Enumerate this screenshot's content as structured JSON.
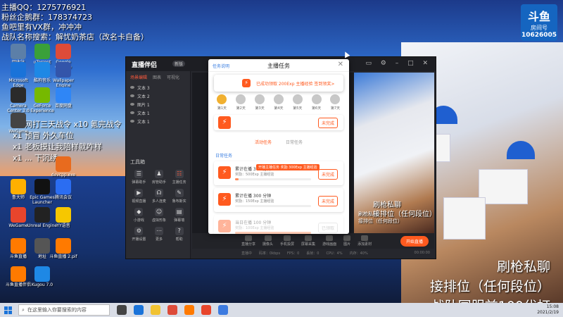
{
  "overlay_lines": [
    "主播QQ：1275776921",
    "粉丝企鹅群：178374723",
    "鱼吧里有VX群，冲冲冲",
    "战队名称搜索：解忧奶茶店（改名卡自备）"
  ],
  "gift_lines": [
    "x1 网打三天战令 x10 氪完战令",
    "x1 预冒 外久车位",
    "x1 老板摸让我陪样就咋样",
    "x1 ... 下沉绣"
  ],
  "promo_lines": [
    "刷枪私聊",
    "接排位（任何段位）",
    "战队国服前100代打"
  ],
  "preview_lines": [
    "刷枪私聊",
    "接排位（任何段位）"
  ],
  "douyu": {
    "mark": "斗鱼",
    "sub": "房间号",
    "room": "10626005"
  },
  "desktop_icons": [
    {
      "label": "回收站",
      "color": "#5c7fa8"
    },
    {
      "label": "uTorrent",
      "color": "#3aa03a"
    },
    {
      "label": "Google Chrome",
      "color": "#dd4b39"
    },
    {
      "label": "Microsoft Edge",
      "color": "#1a73d9"
    },
    {
      "label": "酷狗音乐",
      "color": "#1e88e5"
    },
    {
      "label": "Wallpaper Engine",
      "color": "#3355aa"
    },
    {
      "label": "Camera Center 3.0",
      "color": "#2b2b2b"
    },
    {
      "label": "GeForce Experience",
      "color": "#76b900"
    },
    {
      "label": "百度网盘",
      "color": "#2f86f6"
    },
    {
      "label": "WeGame",
      "color": "#444"
    },
    {
      "label": "devcpp.exe",
      "color": "#e86b1e"
    },
    {
      "label": "鲁大师",
      "color": "#ffb000"
    },
    {
      "label": "Epic Games Launcher",
      "color": "#111"
    },
    {
      "label": "腾讯会议",
      "color": "#2b6df2"
    },
    {
      "label": "WeGame",
      "color": "#e8452c"
    },
    {
      "label": "Unreal Engine",
      "color": "#222"
    },
    {
      "label": "YY语音",
      "color": "#f6c700"
    },
    {
      "label": "斗鱼直播",
      "color": "#ff7a00"
    },
    {
      "label": "地址",
      "color": "#555"
    },
    {
      "label": "斗鱼直播 2.pif",
      "color": "#ff7a00"
    },
    {
      "label": "斗鱼直播伴侣",
      "color": "#ff7a00"
    },
    {
      "label": "Kugou 7.0",
      "color": "#1e88e5"
    }
  ],
  "helper": {
    "logo": "直播伴侣",
    "version": "新版",
    "left_tabs": [
      "场景编辑",
      "图表",
      "可视化"
    ],
    "scenes": [
      "文本 3",
      "文本 2",
      "图片 1",
      "文本 1",
      "文本 1"
    ],
    "tools_title": "工具箱",
    "tools": [
      {
        "label": "弹幕助手",
        "icon": "☰"
      },
      {
        "label": "房管助手",
        "icon": "♟"
      },
      {
        "label": "主播任务",
        "icon": "☷"
      },
      {
        "label": "视频直播",
        "icon": "▶"
      },
      {
        "label": "多人连麦",
        "icon": "☊"
      },
      {
        "label": "鲁布斯实",
        "icon": "✎"
      },
      {
        "label": "小游戏",
        "icon": "◆"
      },
      {
        "label": "虚拟形象",
        "icon": "☺"
      },
      {
        "label": "弹幕墙",
        "icon": "▤"
      },
      {
        "label": "开播设置",
        "icon": "⚙"
      },
      {
        "label": "更多",
        "icon": "⋯"
      },
      {
        "label": "帮助",
        "icon": "?"
      }
    ],
    "bottom_items": [
      "直播分享",
      "摄像头",
      "手机投屏",
      "屏幕采集",
      "游戏画面",
      "图片",
      "添加素材"
    ],
    "start_live": "开始直播",
    "status_items": [
      "直播中",
      "码率：0kbps",
      "FPS：0",
      "丢帧：0",
      "CPU：4%",
      "内存：40%"
    ],
    "time": "00:00:00"
  },
  "task_panel": {
    "link": "任务说明",
    "title": "主播任务",
    "notice": "已成功领取 200Exp 主播经验  签到领奖>",
    "days": [
      "第1天",
      "第2天",
      "第3天",
      "第4天",
      "第5天",
      "第6天",
      "第7天"
    ],
    "tabs": [
      "活动任务",
      "日常任务"
    ],
    "section": "日常任务",
    "tasks": [
      {
        "title": "累计在播 300 分钟",
        "reward": "奖励：500Exp 主播经验",
        "tip": "开播主播任务  奖励 300Exp 主播经验",
        "button": "未完成",
        "progress": 0.05
      },
      {
        "title": "累计在播 300 分钟",
        "reward": "奖励：150Exp 主播经验",
        "tip": "",
        "button": "未完成",
        "progress": 0.0
      },
      {
        "title": "当日在播 100 分钟",
        "reward": "奖励：100Exp 主播经验",
        "tip": "",
        "button": "已领取",
        "progress": 1.0
      }
    ],
    "top_task": {
      "title": "活动任务开启中",
      "button": "未完成"
    }
  },
  "taskbar": {
    "search_placeholder": "在这里输入你要搜索的内容",
    "clock": "15:08",
    "date": "2021/2/19"
  }
}
